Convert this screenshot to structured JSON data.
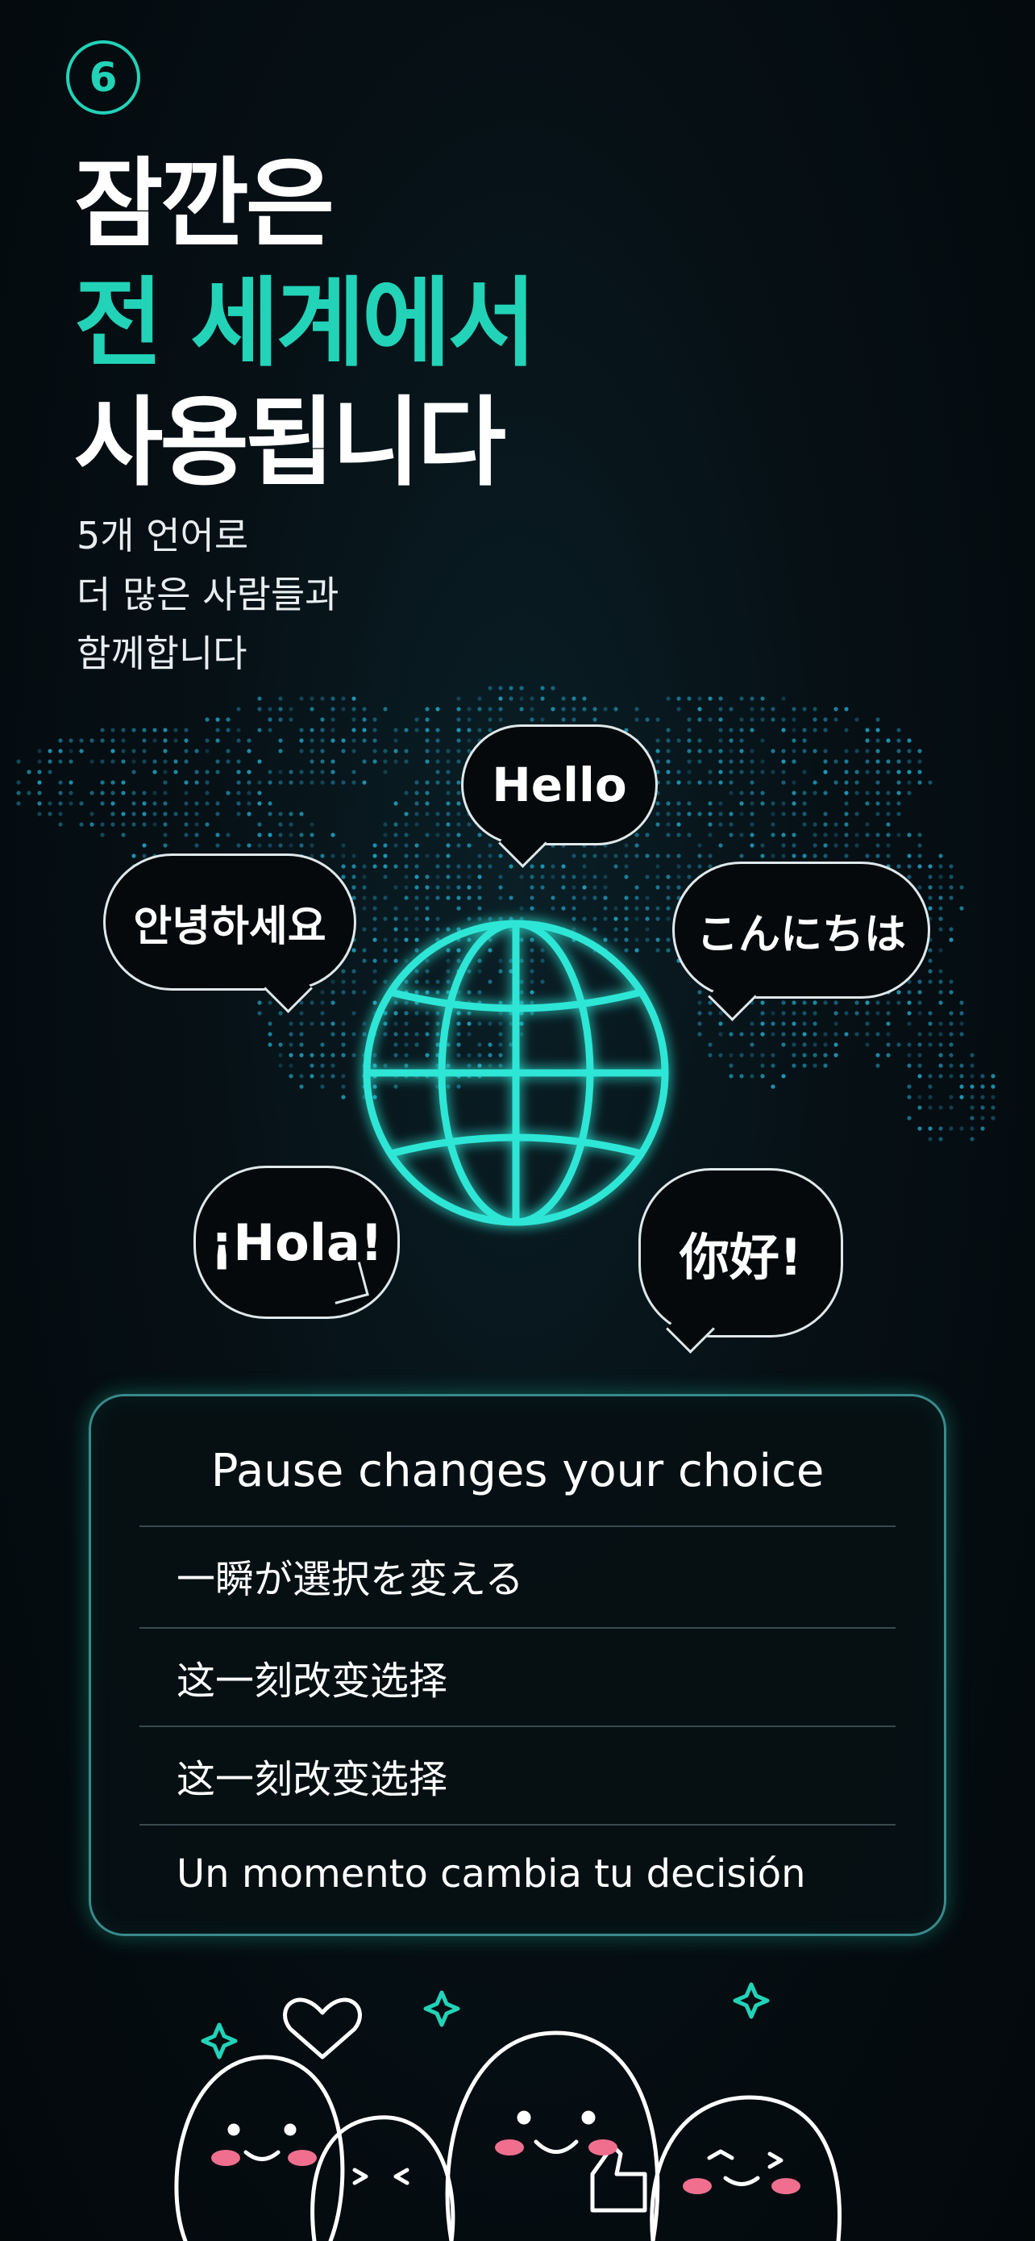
{
  "badge": {
    "number": "6"
  },
  "headline": {
    "line1": "잠깐은",
    "line2": "전 세계에서",
    "line3": "사용됩니다"
  },
  "subtext": {
    "line1": "5개 언어로",
    "line2": "더 많은 사람들과",
    "line3": "함께합니다"
  },
  "bubbles": {
    "hello": "Hello",
    "korean": "안녕하세요",
    "japanese": "こんにちは",
    "spanish": "¡Hola!",
    "chinese": "你好!"
  },
  "card": {
    "title": "Pause changes your choice",
    "rows": [
      "一瞬が選択を変える",
      "这一刻改变选择",
      "这一刻改变选择",
      "Un momento cambia tu decisión"
    ]
  },
  "colors": {
    "accent": "#22d3b8",
    "background": "#061015",
    "card_border": "#3a8a8c"
  },
  "icons": [
    "globe-icon",
    "heart-icon",
    "sparkle-icon",
    "thumbs-up-icon"
  ]
}
